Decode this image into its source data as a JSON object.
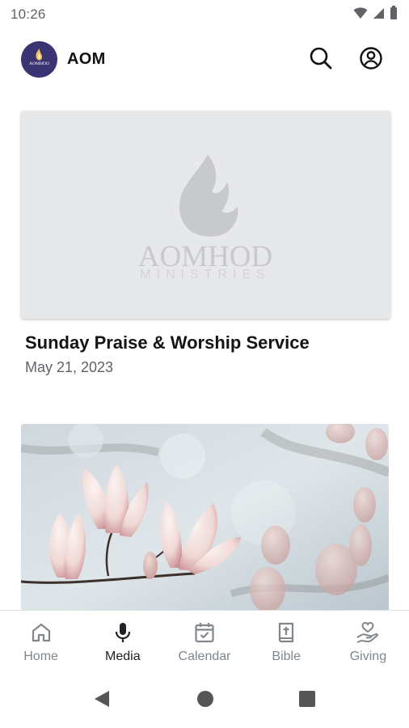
{
  "status_bar": {
    "time": "10:26",
    "icons": [
      "wifi-icon",
      "cellular-signal-icon",
      "battery-icon"
    ]
  },
  "app_bar": {
    "title": "AOM",
    "logo_text": "AOMHOD",
    "icons": [
      "search-icon",
      "account-circle-icon"
    ]
  },
  "media": {
    "items": [
      {
        "title": "Sunday Praise & Worship Service",
        "date": "May 21, 2023",
        "thumbnail": {
          "wordmark": "AOMHOD",
          "subtitle": "MINISTRIES"
        }
      },
      {
        "title": "",
        "date": "",
        "thumbnail": {}
      }
    ]
  },
  "bottom_nav": {
    "items": [
      {
        "label": "Home",
        "icon": "home-icon",
        "active": false
      },
      {
        "label": "Media",
        "icon": "microphone-icon",
        "active": true
      },
      {
        "label": "Calendar",
        "icon": "calendar-check-icon",
        "active": false
      },
      {
        "label": "Bible",
        "icon": "bible-icon",
        "active": false
      },
      {
        "label": "Giving",
        "icon": "giving-heart-hand-icon",
        "active": false
      }
    ]
  },
  "system_nav": {
    "icons": [
      "back-icon",
      "home-circle-icon",
      "recents-icon"
    ]
  },
  "colors": {
    "logo_background": "#3b3472",
    "placeholder_background": "#e7e8ea",
    "placeholder_mark": "#c8c9cc",
    "active_nav": "#202124",
    "inactive_nav": "#80868b"
  }
}
